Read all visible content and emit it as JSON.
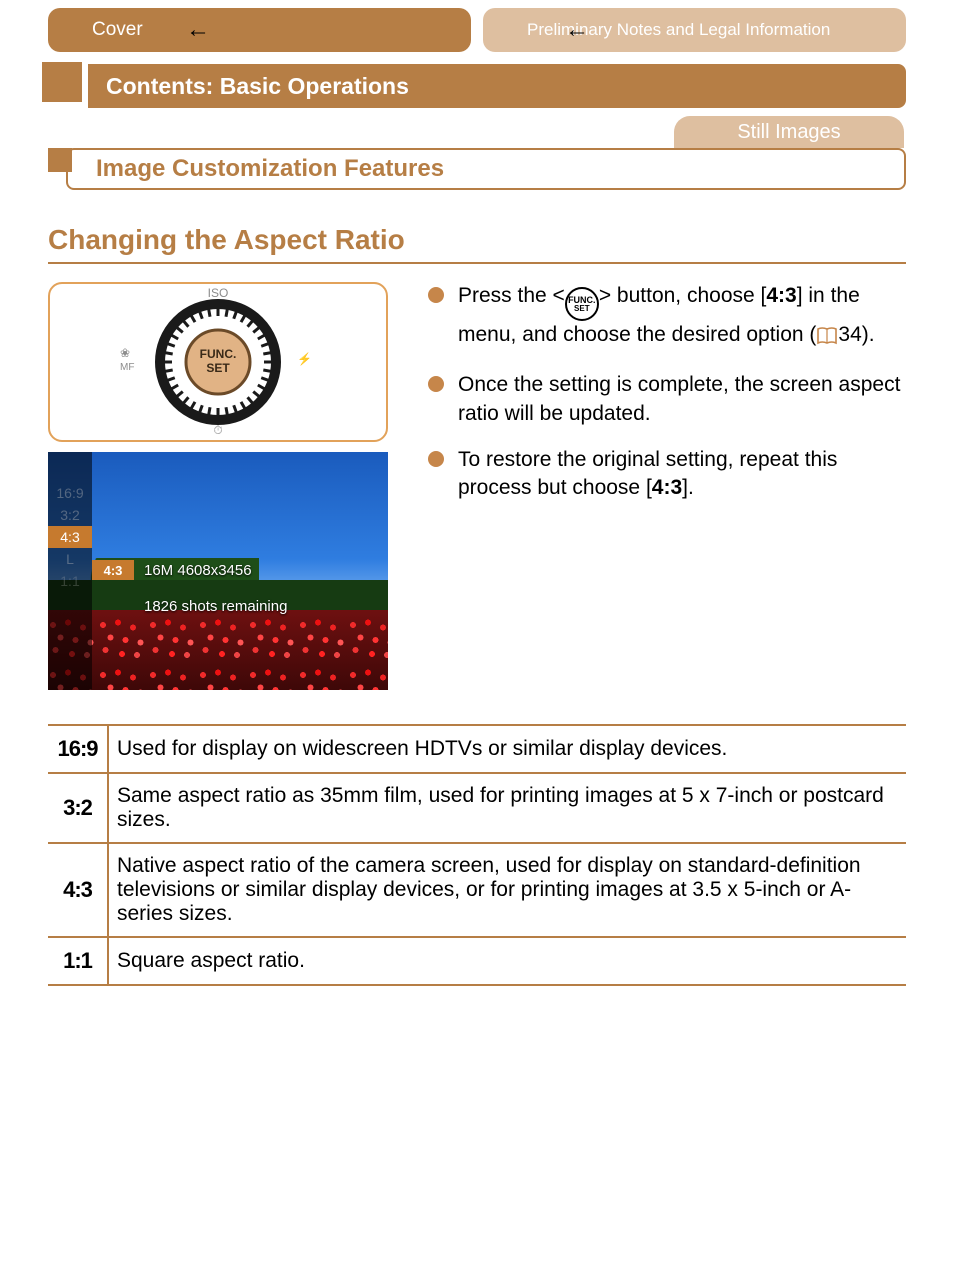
{
  "nav": {
    "left_pill": "Cover",
    "right_pill": "Preliminary Notes and Legal Information"
  },
  "chapter": "Contents: Basic Operations",
  "tab": "Still Images",
  "section": "Image Customization Features",
  "heading": "Changing the Aspect Ratio",
  "dial": {
    "iso": "ISO",
    "mf": "MF",
    "center_top": "FUNC.",
    "center_bot": "SET"
  },
  "lcd": {
    "options": [
      "16:9",
      "3:2",
      "4:3",
      "1:1"
    ],
    "left_extra_top": "4:3",
    "left_extra_bot": "L",
    "selected": "4:3",
    "info_line1": "16M 4608x3456",
    "info_line2": "1826 shots remaining"
  },
  "bullets": {
    "b1_a": "Press the <",
    "b1_b": "> button, choose [",
    "b1_ratio": "4:3",
    "b1_c": "] in the menu, and choose the desired option (",
    "b1_page": "34",
    "b1_d": ").",
    "b2": "Once the setting is complete, the screen aspect ratio will be updated.",
    "b3_a": "To restore the original setting, repeat this process but choose [",
    "b3_ratio": "4:3",
    "b3_b": "]."
  },
  "table": {
    "r1_ratio": "16:9",
    "r1_desc": "Used for display on widescreen HDTVs or similar display devices.",
    "r2_ratio": "3:2",
    "r2_desc": "Same aspect ratio as 35mm film, used for printing images at 5 x 7-inch or postcard sizes.",
    "r3_ratio": "4:3",
    "r3_desc": "Native aspect ratio of the camera screen, used for display on standard-definition televisions or similar display devices, or for printing images at 3.5 x 5-inch or A-series sizes.",
    "r4_ratio": "1:1",
    "r4_desc": "Square aspect ratio."
  }
}
